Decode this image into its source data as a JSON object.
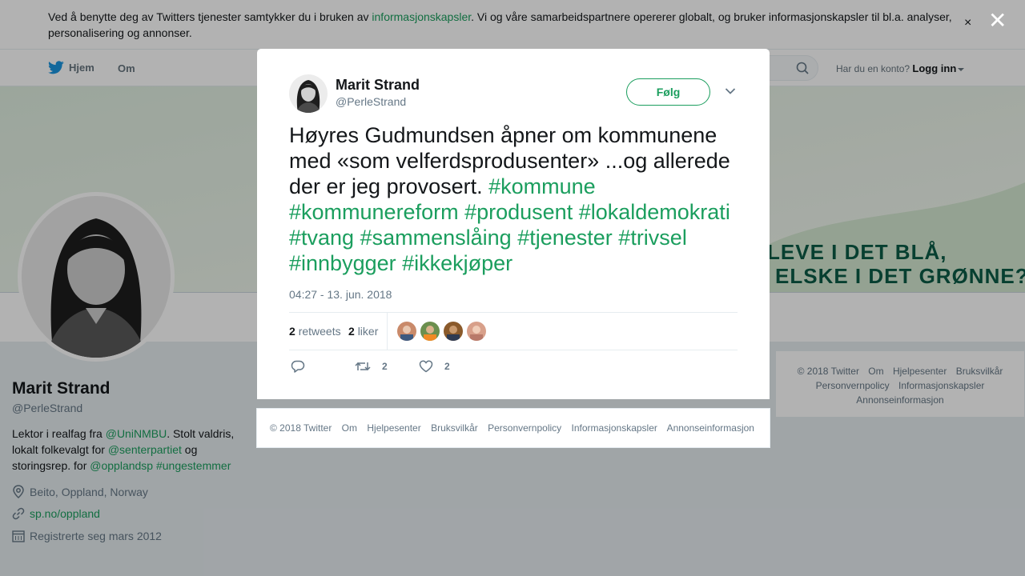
{
  "cookie": {
    "text_before": "Ved å benytte deg av Twitters tjenester samtykker du i bruken av ",
    "link": "informasjonskapsler",
    "text_after": ". Vi og våre samarbeidspartnere opererer globalt, og bruker informasjonskapsler til bl.a. analyser, personalisering og annonser.",
    "close": "×"
  },
  "nav": {
    "home": "Hjem",
    "about": "Om",
    "login_prompt": "Har du en konto?",
    "login": "Logg inn"
  },
  "banner": {
    "line1": "LEVE I DET BLÅ,",
    "line2": "ELSKE I DET GRØNNE?"
  },
  "profile": {
    "name": "Marit Strand",
    "handle": "@PerleStrand",
    "bio": {
      "t1": "Lektor i realfag fra ",
      "m1": "@UniNMBU",
      "t2": ". Stolt valdris, lokalt folkevalgt for ",
      "m2": "@senterpartiet",
      "t3": " og storingsrep. for ",
      "m3": "@opplandsp",
      "t4": " ",
      "h1": "#ungestemmer"
    },
    "location": "Beito, Oppland, Norway",
    "url": "sp.no/oppland",
    "joined": "Registrerte seg mars 2012"
  },
  "side_footer": {
    "items": [
      "© 2018 Twitter",
      "Om",
      "Hjelpesenter",
      "Bruksvilkår",
      "Personvernpolicy",
      "Informasjonskapsler",
      "Annonseinformasjon"
    ]
  },
  "overlay": {
    "close": "✕"
  },
  "tweet": {
    "author_name": "Marit Strand",
    "author_handle": "@PerleStrand",
    "follow_label": "Følg",
    "text_plain": "Høyres Gudmundsen åpner om kommunene med «som velferdsprodusenter» ...og allerede der er jeg provosert. ",
    "hashtags": [
      "#kommune",
      "#kommunereform",
      "#produsent",
      "#lokaldemokrati",
      "#tvang",
      "#sammenslåing",
      "#tjenester",
      "#trivsel",
      "#innbygger",
      "#ikkekjøper"
    ],
    "timestamp": "04:27 - 13. jun. 2018",
    "retweets_count": "2",
    "retweets_label": "retweets",
    "likes_count": "2",
    "likes_label": "liker",
    "retweet_action_count": "2",
    "like_action_count": "2",
    "liker_colors": [
      "#c98a6a",
      "#6b8f4e",
      "#8a5a2b",
      "#d8a08a"
    ]
  },
  "modal_footer": {
    "items": [
      "© 2018 Twitter",
      "Om",
      "Hjelpesenter",
      "Bruksvilkår",
      "Personvernpolicy",
      "Informasjonskapsler",
      "Annonseinformasjon"
    ]
  },
  "colors": {
    "accent": "#1b9e5e",
    "text": "#14171a",
    "muted": "#657786"
  }
}
